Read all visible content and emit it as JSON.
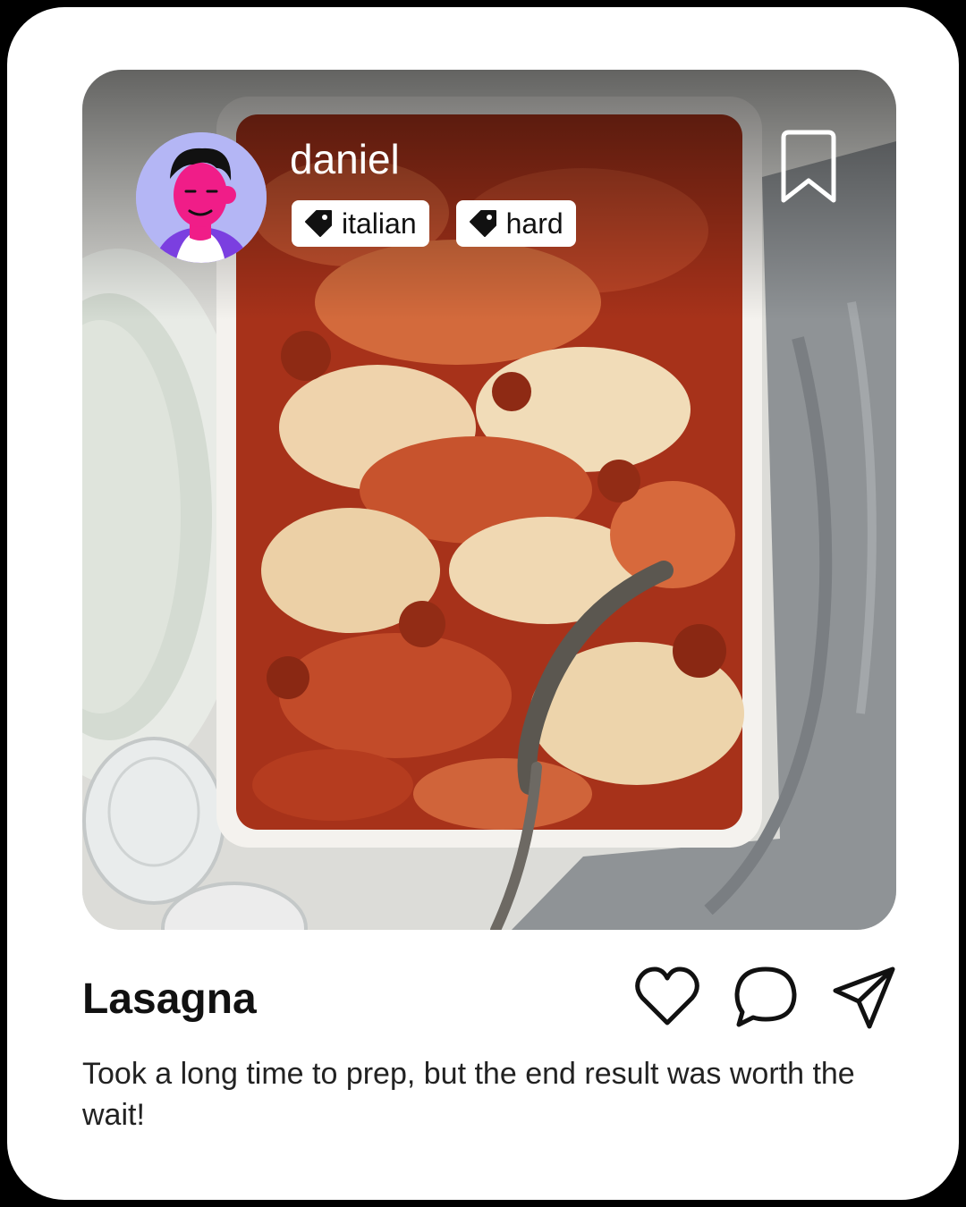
{
  "post": {
    "username": "daniel",
    "tags": [
      {
        "icon": "tag-icon",
        "label": "italian"
      },
      {
        "icon": "tag-icon",
        "label": "hard"
      }
    ],
    "title": "Lasagna",
    "caption": "Took a long time to prep, but the end result was worth the wait!",
    "icons": {
      "bookmark": "bookmark-icon",
      "like": "heart-icon",
      "comment": "comment-icon",
      "share": "send-icon"
    }
  },
  "colors": {
    "card": "#ffffff",
    "avatar_bg": "#b4b6f5",
    "sauce": "#b3361b",
    "cheese": "#f1d9b5"
  }
}
